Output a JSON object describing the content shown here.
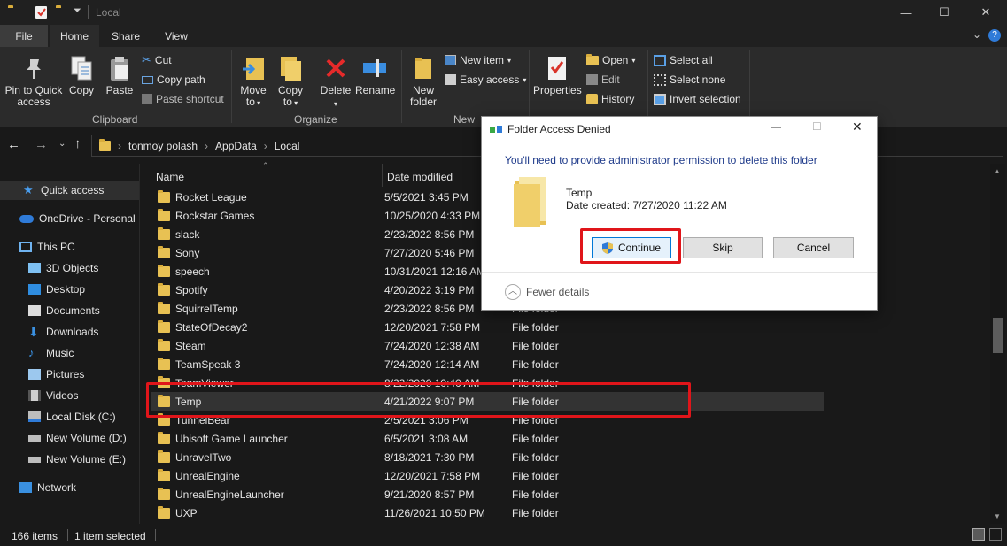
{
  "window": {
    "title": "Local"
  },
  "tabs": [
    "File",
    "Home",
    "Share",
    "View"
  ],
  "ribbon": {
    "clipboard": {
      "pin": "Pin to Quick access",
      "copy": "Copy",
      "paste": "Paste",
      "cut": "Cut",
      "copy_path": "Copy path",
      "paste_shortcut": "Paste shortcut",
      "label": "Clipboard"
    },
    "organize": {
      "move_to": "Move to",
      "copy_to": "Copy to",
      "delete": "Delete",
      "rename": "Rename",
      "label": "Organize"
    },
    "new": {
      "new_folder": "New folder",
      "new_item": "New item",
      "easy_access": "Easy access",
      "label": "New"
    },
    "open": {
      "properties": "Properties",
      "open": "Open",
      "edit": "Edit",
      "history": "History"
    },
    "select": {
      "select_all": "Select all",
      "select_none": "Select none",
      "invert_selection": "Invert selection"
    }
  },
  "address": {
    "segments": [
      "tonmoy polash",
      "AppData",
      "Local"
    ]
  },
  "sidebar": {
    "items": [
      "Quick access",
      "OneDrive - Personal",
      "This PC",
      "3D Objects",
      "Desktop",
      "Documents",
      "Downloads",
      "Music",
      "Pictures",
      "Videos",
      "Local Disk (C:)",
      "New Volume (D:)",
      "New Volume (E:)",
      "Network"
    ]
  },
  "filelist": {
    "headers": {
      "name": "Name",
      "date": "Date modified"
    },
    "rows": [
      {
        "name": "Rocket League",
        "date": "5/5/2021 3:45 PM",
        "type": ""
      },
      {
        "name": "Rockstar Games",
        "date": "10/25/2020 4:33 PM",
        "type": ""
      },
      {
        "name": "slack",
        "date": "2/23/2022 8:56 PM",
        "type": ""
      },
      {
        "name": "Sony",
        "date": "7/27/2020 5:46 PM",
        "type": ""
      },
      {
        "name": "speech",
        "date": "10/31/2021 12:16 AM",
        "type": ""
      },
      {
        "name": "Spotify",
        "date": "4/20/2022 3:19 PM",
        "type": ""
      },
      {
        "name": "SquirrelTemp",
        "date": "2/23/2022 8:56 PM",
        "type": "File folder"
      },
      {
        "name": "StateOfDecay2",
        "date": "12/20/2021 7:58 PM",
        "type": "File folder"
      },
      {
        "name": "Steam",
        "date": "7/24/2020 12:38 AM",
        "type": "File folder"
      },
      {
        "name": "TeamSpeak 3",
        "date": "7/24/2020 12:14 AM",
        "type": "File folder"
      },
      {
        "name": "TeamViewer",
        "date": "8/22/2020 10:40 AM",
        "type": "File folder"
      },
      {
        "name": "Temp",
        "date": "4/21/2022 9:07 PM",
        "type": "File folder"
      },
      {
        "name": "TunnelBear",
        "date": "2/5/2021 3:06 PM",
        "type": "File folder"
      },
      {
        "name": "Ubisoft Game Launcher",
        "date": "6/5/2021 3:08 AM",
        "type": "File folder"
      },
      {
        "name": "UnravelTwo",
        "date": "8/18/2021 7:30 PM",
        "type": "File folder"
      },
      {
        "name": "UnrealEngine",
        "date": "12/20/2021 7:58 PM",
        "type": "File folder"
      },
      {
        "name": "UnrealEngineLauncher",
        "date": "9/21/2020 8:57 PM",
        "type": "File folder"
      },
      {
        "name": "UXP",
        "date": "11/26/2021 10:50 PM",
        "type": "File folder"
      }
    ],
    "selected_index": 11
  },
  "status": {
    "items": "166 items",
    "selected": "1 item selected"
  },
  "dialog": {
    "title": "Folder Access Denied",
    "message": "You'll need to provide administrator permission to delete this folder",
    "item_name": "Temp",
    "item_date": "Date created: 7/27/2020 11:22 AM",
    "continue": "Continue",
    "skip": "Skip",
    "cancel": "Cancel",
    "fewer_details": "Fewer details"
  },
  "colors": {
    "highlight_red": "#e0151a",
    "folder_yellow": "#e8c153",
    "accent_blue": "#2f7bd8"
  }
}
